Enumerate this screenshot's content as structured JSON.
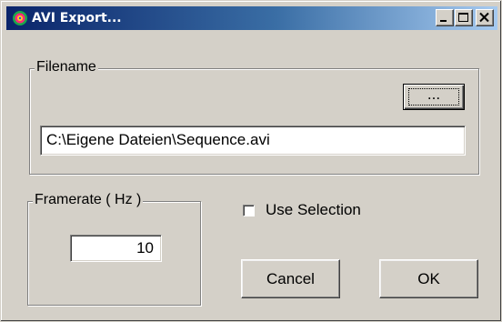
{
  "window": {
    "title": "AVI Export...",
    "app_icon": "colorful-globe-icon",
    "controls": [
      "minimize-icon",
      "maximize-icon",
      "close-icon"
    ]
  },
  "filename_group": {
    "label": "Filename",
    "browse_label": "...",
    "path_value": "C:\\Eigene Dateien\\Sequence.avi"
  },
  "framerate_group": {
    "label": "Framerate ( Hz )",
    "value": "10"
  },
  "use_selection": {
    "label": "Use Selection",
    "checked": false
  },
  "buttons": {
    "cancel_label": "Cancel",
    "ok_label": "OK"
  },
  "colors": {
    "titlebar_start": "#0a246a",
    "titlebar_end": "#a6caf0",
    "dialog_face": "#d4d0c8"
  }
}
